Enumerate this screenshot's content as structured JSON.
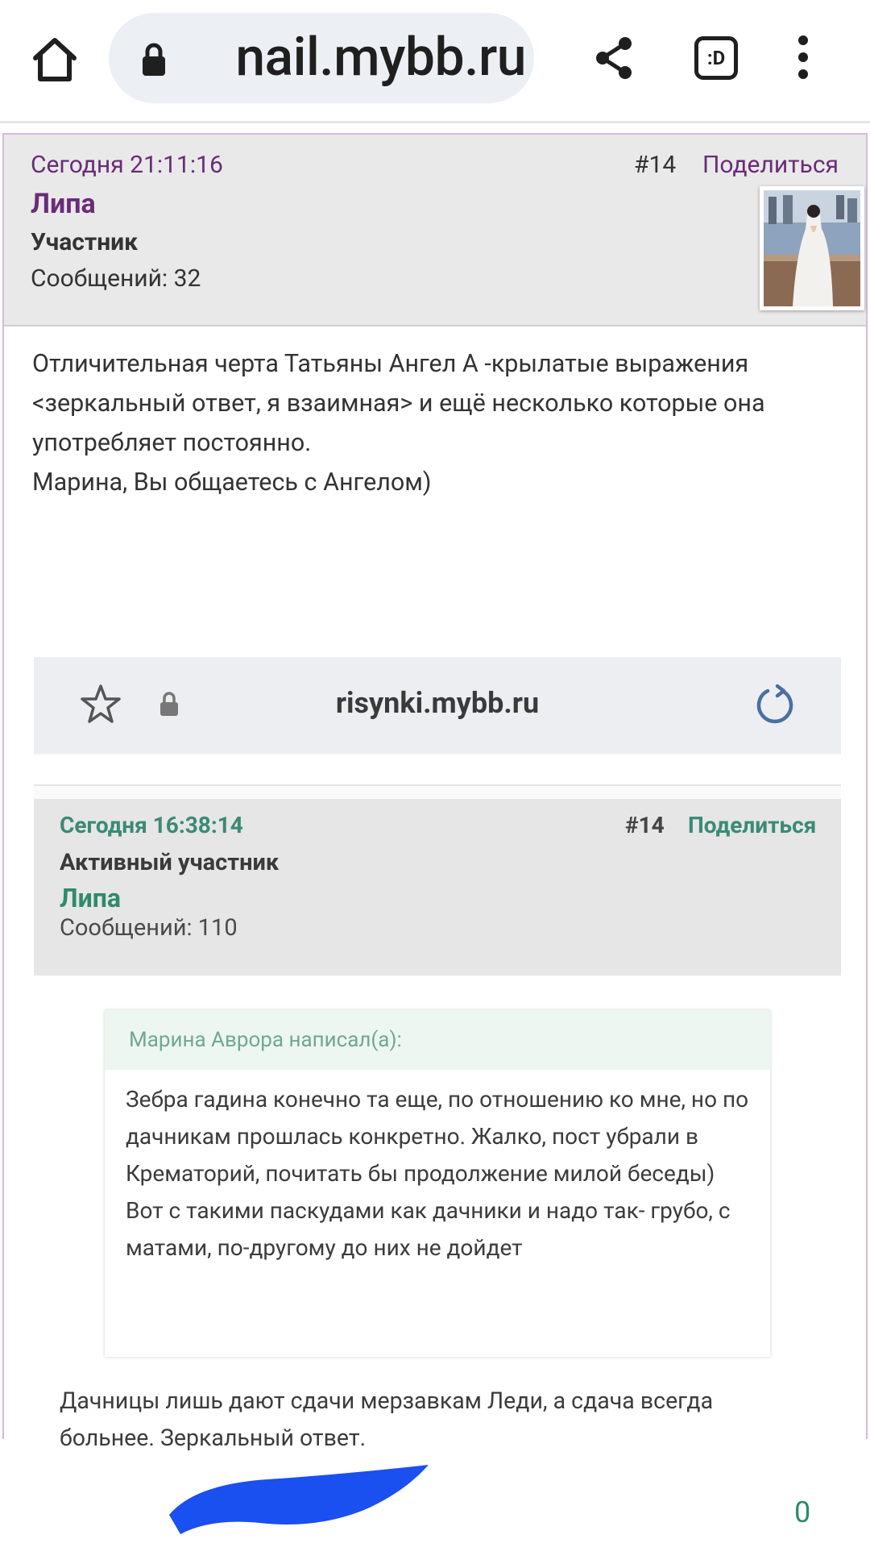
{
  "browser": {
    "url": "nail.mybb.ru",
    "tabs_glyph": ":D"
  },
  "post": {
    "timestamp": "Сегодня 21:11:16",
    "number": "#14",
    "share_label": "Поделиться",
    "author": "Липа",
    "role": "Участник",
    "messages": "Сообщений: 32",
    "body": [
      "Отличительная черта Татьяны Ангел А -крылатые выражения <зеркальный ответ, я взаимная> и ещё несколько которые она употребляет постоянно.",
      "Марина, Вы общаетесь с Ангелом)"
    ]
  },
  "embedded": {
    "url": "risynki.mybb.ru",
    "timestamp": "Сегодня 16:38:14",
    "number": "#14",
    "share_label": "Поделиться",
    "role": "Активный участник",
    "author": "Липа",
    "messages": "Сообщений: 110",
    "quote_header": "Марина Аврора написал(а):",
    "quote_lines": [
      "Зебра гадина конечно та еще, по отношению ко мне, но по дачникам прошлась конкретно. Жалко, пост убрали в Крематорий, почитать бы продолжение милой беседы)",
      "Вот с такими паскудами как дачники и надо так- грубо, с матами, по-другому до них не дойдет"
    ],
    "reply": "Дачницы лишь дают сдачи мерзавкам Леди, а сдача всегда больнее. Зеркальный ответ.",
    "counter": "0",
    "scribble_color": "#1a4ff0"
  },
  "colors": {
    "forum_accent": "#6a2c78",
    "embedded_accent": "#2f8a6c"
  }
}
